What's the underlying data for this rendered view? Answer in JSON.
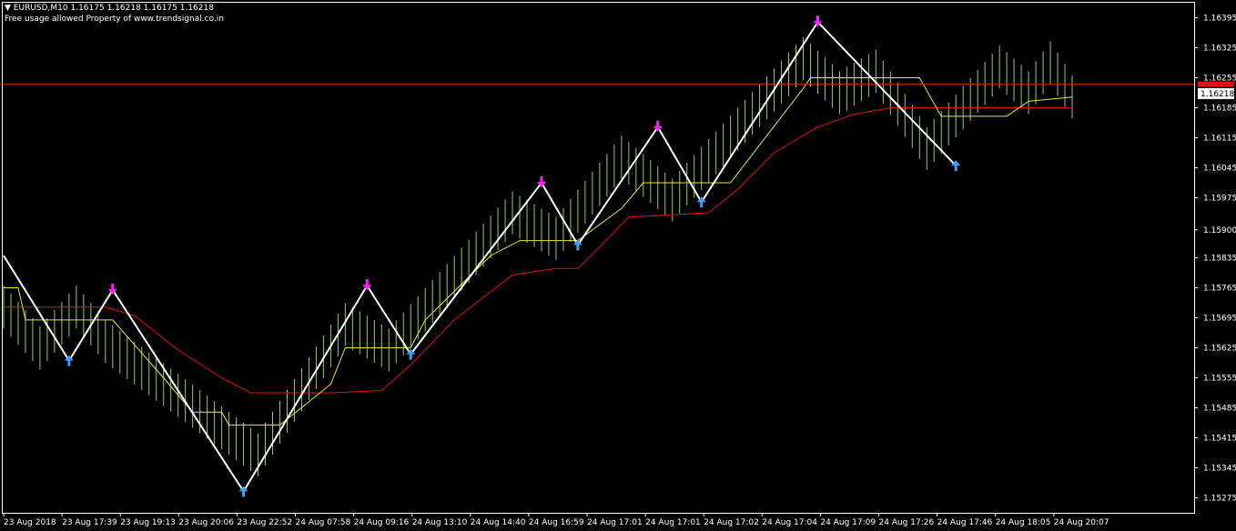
{
  "header": {
    "symbol_line": "EURUSD,M10  1.16175 1.16218 1.16175 1.16218",
    "notice": "Free usage allowed Property of www.trendsignal.co.in"
  },
  "colors": {
    "background": "#000000",
    "frame": "#ffffff",
    "grid": "#1e2a1e",
    "bands": "#8fd05a",
    "zigzag": "#ffffff",
    "fast_line": "#e8e830",
    "slow_line": "#e01010",
    "resistance": "#e01010",
    "sell_arrow": "#ff20ff",
    "buy_arrow": "#3aa0ff",
    "price_tag": "#ffffff"
  },
  "chart_data": {
    "type": "line",
    "symbol": "EURUSD",
    "timeframe": "M10",
    "ohlc_last": {
      "open": 1.16175,
      "high": 1.16218,
      "low": 1.16175,
      "close": 1.16218
    },
    "current_price": "1.16218",
    "resistance_price": "1.16240",
    "y_ticks": [
      "1.16395",
      "1.16325",
      "1.16255",
      "1.16185",
      "1.16115",
      "1.16045",
      "1.15975",
      "1.15900",
      "1.15835",
      "1.15765",
      "1.15695",
      "1.15625",
      "1.15555",
      "1.15485",
      "1.15415",
      "1.15345",
      "1.15275"
    ],
    "ylim": [
      1.1524,
      1.1643
    ],
    "x_ticks": [
      "23 Aug 2018",
      "23 Aug 17:39",
      "23 Aug 19:13",
      "23 Aug 20:06",
      "23 Aug 22:52",
      "24 Aug 07:58",
      "24 Aug 09:16",
      "24 Aug 13:10",
      "24 Aug 14:40",
      "24 Aug 16:59",
      "24 Aug 17:01",
      "24 Aug 17:01",
      "24 Aug 17:02",
      "24 Aug 17:04",
      "24 Aug 17:09",
      "24 Aug 17:26",
      "24 Aug 17:46",
      "24 Aug 18:05",
      "24 Aug 20:07"
    ],
    "bar_count": 148,
    "zigzag": [
      {
        "bar": 0,
        "price": 1.1584
      },
      {
        "bar": 9,
        "price": 1.15595
      },
      {
        "bar": 15,
        "price": 1.1576
      },
      {
        "bar": 33,
        "price": 1.1529
      },
      {
        "bar": 50,
        "price": 1.1577
      },
      {
        "bar": 56,
        "price": 1.1561
      },
      {
        "bar": 74,
        "price": 1.1601
      },
      {
        "bar": 79,
        "price": 1.15865
      },
      {
        "bar": 90,
        "price": 1.1614
      },
      {
        "bar": 96,
        "price": 1.15965
      },
      {
        "bar": 112,
        "price": 1.16385
      },
      {
        "bar": 131,
        "price": 1.1605
      }
    ],
    "signals": [
      {
        "type": "buy",
        "bar": 9,
        "price": 1.15595
      },
      {
        "type": "sell",
        "bar": 15,
        "price": 1.1576
      },
      {
        "type": "buy",
        "bar": 33,
        "price": 1.1529
      },
      {
        "type": "sell",
        "bar": 50,
        "price": 1.1577
      },
      {
        "type": "buy",
        "bar": 56,
        "price": 1.1561
      },
      {
        "type": "sell",
        "bar": 74,
        "price": 1.1601
      },
      {
        "type": "buy",
        "bar": 79,
        "price": 1.15865
      },
      {
        "type": "sell",
        "bar": 90,
        "price": 1.1614
      },
      {
        "type": "buy",
        "bar": 96,
        "price": 1.15965
      },
      {
        "type": "sell",
        "bar": 112,
        "price": 1.16385
      },
      {
        "type": "buy",
        "bar": 131,
        "price": 1.1605
      }
    ],
    "band_points": [
      {
        "bar": 0,
        "mid": 1.1572
      },
      {
        "bar": 5,
        "mid": 1.15625
      },
      {
        "bar": 10,
        "mid": 1.1572
      },
      {
        "bar": 14,
        "mid": 1.1564
      },
      {
        "bar": 35,
        "mid": 1.15375
      },
      {
        "bar": 47,
        "mid": 1.1568
      },
      {
        "bar": 53,
        "mid": 1.1562
      },
      {
        "bar": 70,
        "mid": 1.1594
      },
      {
        "bar": 76,
        "mid": 1.1588
      },
      {
        "bar": 85,
        "mid": 1.1607
      },
      {
        "bar": 92,
        "mid": 1.1597
      },
      {
        "bar": 110,
        "mid": 1.163
      },
      {
        "bar": 115,
        "mid": 1.1622
      },
      {
        "bar": 120,
        "mid": 1.1627
      },
      {
        "bar": 127,
        "mid": 1.1609
      },
      {
        "bar": 137,
        "mid": 1.1628
      },
      {
        "bar": 141,
        "mid": 1.1622
      },
      {
        "bar": 144,
        "mid": 1.1629
      },
      {
        "bar": 147,
        "mid": 1.1621
      }
    ],
    "band_half_width": 0.0005,
    "fast_line": [
      {
        "bar": 0,
        "price": 1.15765
      },
      {
        "bar": 2,
        "price": 1.15765
      },
      {
        "bar": 3,
        "price": 1.1569
      },
      {
        "bar": 15,
        "price": 1.1569
      },
      {
        "bar": 22,
        "price": 1.15555
      },
      {
        "bar": 26,
        "price": 1.15475
      },
      {
        "bar": 30,
        "price": 1.15475
      },
      {
        "bar": 31,
        "price": 1.15445
      },
      {
        "bar": 38,
        "price": 1.15445
      },
      {
        "bar": 45,
        "price": 1.1554
      },
      {
        "bar": 47,
        "price": 1.15625
      },
      {
        "bar": 56,
        "price": 1.15625
      },
      {
        "bar": 58,
        "price": 1.1569
      },
      {
        "bar": 67,
        "price": 1.1584
      },
      {
        "bar": 71,
        "price": 1.15875
      },
      {
        "bar": 79,
        "price": 1.15875
      },
      {
        "bar": 85,
        "price": 1.1595
      },
      {
        "bar": 88,
        "price": 1.1601
      },
      {
        "bar": 100,
        "price": 1.1601
      },
      {
        "bar": 110,
        "price": 1.1623
      },
      {
        "bar": 111,
        "price": 1.16255
      },
      {
        "bar": 126,
        "price": 1.16255
      },
      {
        "bar": 129,
        "price": 1.16165
      },
      {
        "bar": 138,
        "price": 1.16165
      },
      {
        "bar": 141,
        "price": 1.162
      },
      {
        "bar": 147,
        "price": 1.1621
      }
    ],
    "slow_line": [
      {
        "bar": 0,
        "price": 1.1572
      },
      {
        "bar": 14,
        "price": 1.1572
      },
      {
        "bar": 18,
        "price": 1.157
      },
      {
        "bar": 24,
        "price": 1.1562
      },
      {
        "bar": 30,
        "price": 1.15555
      },
      {
        "bar": 34,
        "price": 1.1552
      },
      {
        "bar": 45,
        "price": 1.1552
      },
      {
        "bar": 52,
        "price": 1.15525
      },
      {
        "bar": 56,
        "price": 1.15585
      },
      {
        "bar": 62,
        "price": 1.1569
      },
      {
        "bar": 70,
        "price": 1.15795
      },
      {
        "bar": 76,
        "price": 1.1581
      },
      {
        "bar": 79,
        "price": 1.1581
      },
      {
        "bar": 82,
        "price": 1.1586
      },
      {
        "bar": 86,
        "price": 1.1593
      },
      {
        "bar": 97,
        "price": 1.1594
      },
      {
        "bar": 101,
        "price": 1.15995
      },
      {
        "bar": 106,
        "price": 1.1608
      },
      {
        "bar": 112,
        "price": 1.1614
      },
      {
        "bar": 117,
        "price": 1.1617
      },
      {
        "bar": 122,
        "price": 1.16185
      },
      {
        "bar": 147,
        "price": 1.16185
      }
    ]
  }
}
